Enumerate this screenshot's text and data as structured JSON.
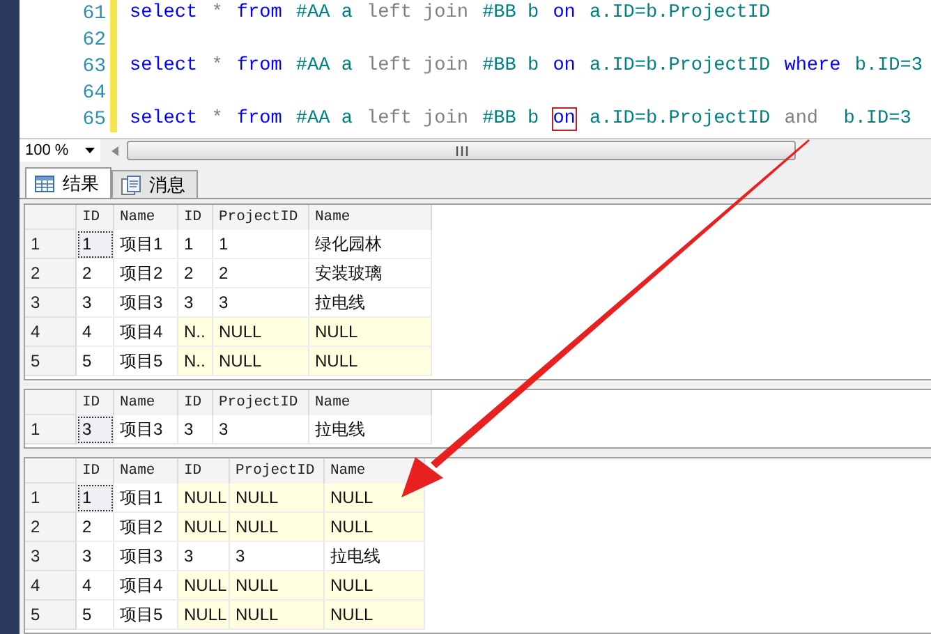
{
  "editor": {
    "lines": [
      {
        "number": "61",
        "tokens": [
          {
            "kind": "kw",
            "text": "select"
          },
          {
            "kind": "op",
            "text": " * "
          },
          {
            "kind": "kw",
            "text": "from"
          },
          {
            "kind": "id",
            "text": " #AA a "
          },
          {
            "kind": "op",
            "text": "left join"
          },
          {
            "kind": "id",
            "text": " #BB b "
          },
          {
            "kind": "kw",
            "text": "on"
          },
          {
            "kind": "id",
            "text": " a.ID=b.ProjectID"
          }
        ]
      },
      {
        "number": "62"
      },
      {
        "number": "63",
        "tokens": [
          {
            "kind": "kw",
            "text": "select"
          },
          {
            "kind": "op",
            "text": " * "
          },
          {
            "kind": "kw",
            "text": "from"
          },
          {
            "kind": "id",
            "text": " #AA a "
          },
          {
            "kind": "op",
            "text": "left join"
          },
          {
            "kind": "id",
            "text": " #BB b "
          },
          {
            "kind": "kw",
            "text": "on"
          },
          {
            "kind": "id",
            "text": " a.ID=b.ProjectID "
          },
          {
            "kind": "kw",
            "text": "where"
          },
          {
            "kind": "id",
            "text": " b.ID=3"
          }
        ]
      },
      {
        "number": "64"
      },
      {
        "number": "65",
        "tokens": [
          {
            "kind": "kw",
            "text": "select"
          },
          {
            "kind": "op",
            "text": " * "
          },
          {
            "kind": "kw",
            "text": "from"
          },
          {
            "kind": "id",
            "text": " #AA a "
          },
          {
            "kind": "op",
            "text": "left join"
          },
          {
            "kind": "id",
            "text": " #BB b "
          },
          {
            "kind": "kw",
            "text": "on",
            "boxed": true
          },
          {
            "kind": "id",
            "text": " a.ID=b.ProjectID "
          },
          {
            "kind": "op",
            "text": "and"
          },
          {
            "kind": "id",
            "text": "  b.ID=3"
          }
        ]
      }
    ],
    "zoom": "100 %"
  },
  "tabs": [
    {
      "label": "结果",
      "selected": true
    },
    {
      "label": "消息",
      "selected": false
    }
  ],
  "grids": [
    {
      "columns": [
        "ID",
        "Name",
        "ID",
        "ProjectID",
        "Name"
      ],
      "rows": [
        {
          "number": "1",
          "focused": true,
          "cells": [
            {
              "text": "1",
              "null": false
            },
            {
              "text": "项目1",
              "null": false
            },
            {
              "text": "1",
              "null": false
            },
            {
              "text": "1",
              "null": false
            },
            {
              "text": "绿化园林",
              "null": false
            }
          ]
        },
        {
          "number": "2",
          "focused": false,
          "cells": [
            {
              "text": "2",
              "null": false
            },
            {
              "text": "项目2",
              "null": false
            },
            {
              "text": "2",
              "null": false
            },
            {
              "text": "2",
              "null": false
            },
            {
              "text": "安装玻璃",
              "null": false
            }
          ]
        },
        {
          "number": "3",
          "focused": false,
          "cells": [
            {
              "text": "3",
              "null": false
            },
            {
              "text": "项目3",
              "null": false
            },
            {
              "text": "3",
              "null": false
            },
            {
              "text": "3",
              "null": false
            },
            {
              "text": "拉电线",
              "null": false
            }
          ]
        },
        {
          "number": "4",
          "focused": false,
          "cells": [
            {
              "text": "4",
              "null": false
            },
            {
              "text": "项目4",
              "null": false
            },
            {
              "text": "N..",
              "null": true
            },
            {
              "text": "NULL",
              "null": true
            },
            {
              "text": "NULL",
              "null": true
            }
          ]
        },
        {
          "number": "5",
          "focused": false,
          "cells": [
            {
              "text": "5",
              "null": false
            },
            {
              "text": "项目5",
              "null": false
            },
            {
              "text": "N..",
              "null": true
            },
            {
              "text": "NULL",
              "null": true
            },
            {
              "text": "NULL",
              "null": true
            }
          ]
        }
      ]
    },
    {
      "columns": [
        "ID",
        "Name",
        "ID",
        "ProjectID",
        "Name"
      ],
      "rows": [
        {
          "number": "1",
          "focused": true,
          "cells": [
            {
              "text": "3",
              "null": false
            },
            {
              "text": "项目3",
              "null": false
            },
            {
              "text": "3",
              "null": false
            },
            {
              "text": "3",
              "null": false
            },
            {
              "text": "拉电线",
              "null": false
            }
          ]
        }
      ]
    },
    {
      "columns": [
        "ID",
        "Name",
        "ID",
        "ProjectID",
        "Name"
      ],
      "rows": [
        {
          "number": "1",
          "focused": true,
          "cells": [
            {
              "text": "1",
              "null": false
            },
            {
              "text": "项目1",
              "null": false
            },
            {
              "text": "NULL",
              "null": true
            },
            {
              "text": "NULL",
              "null": true
            },
            {
              "text": "NULL",
              "null": true
            }
          ]
        },
        {
          "number": "2",
          "focused": false,
          "cells": [
            {
              "text": "2",
              "null": false
            },
            {
              "text": "项目2",
              "null": false
            },
            {
              "text": "NULL",
              "null": true
            },
            {
              "text": "NULL",
              "null": true
            },
            {
              "text": "NULL",
              "null": true
            }
          ]
        },
        {
          "number": "3",
          "focused": false,
          "cells": [
            {
              "text": "3",
              "null": false
            },
            {
              "text": "项目3",
              "null": false
            },
            {
              "text": "3",
              "null": false
            },
            {
              "text": "3",
              "null": false
            },
            {
              "text": "拉电线",
              "null": false
            }
          ]
        },
        {
          "number": "4",
          "focused": false,
          "cells": [
            {
              "text": "4",
              "null": false
            },
            {
              "text": "项目4",
              "null": false
            },
            {
              "text": "NULL",
              "null": true
            },
            {
              "text": "NULL",
              "null": true
            },
            {
              "text": "NULL",
              "null": true
            }
          ]
        },
        {
          "number": "5",
          "focused": false,
          "cells": [
            {
              "text": "5",
              "null": false
            },
            {
              "text": "项目5",
              "null": false
            },
            {
              "text": "NULL",
              "null": true
            },
            {
              "text": "NULL",
              "null": true
            },
            {
              "text": "NULL",
              "null": true
            }
          ]
        }
      ]
    }
  ]
}
